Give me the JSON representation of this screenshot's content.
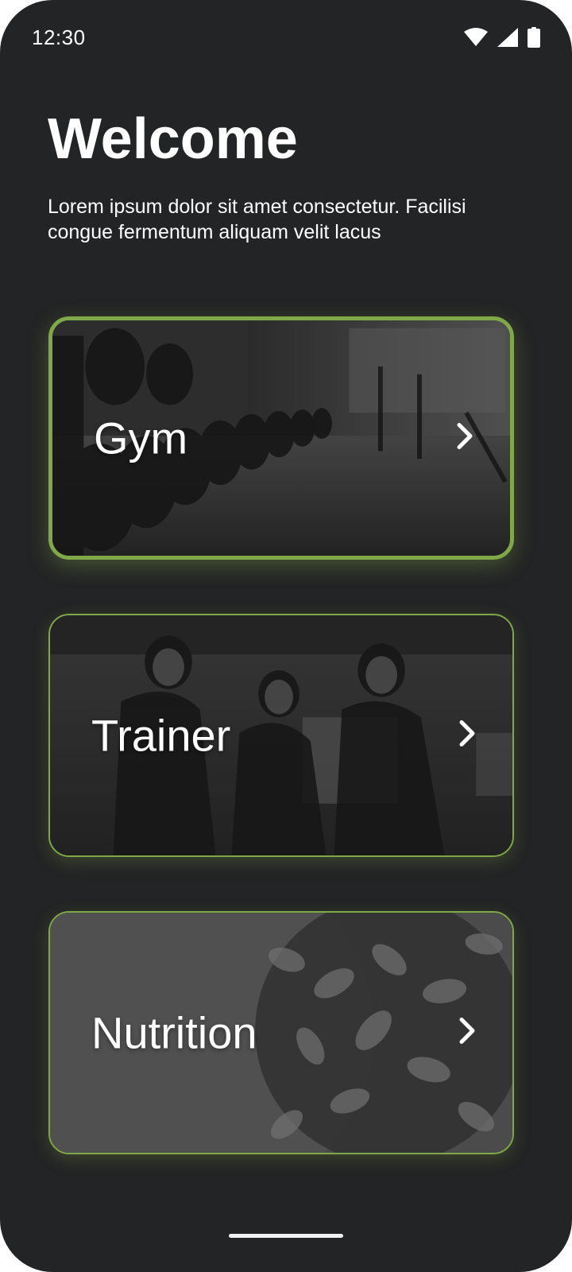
{
  "status_bar": {
    "time": "12:30",
    "icons": [
      "wifi-icon",
      "cellular-signal-icon",
      "battery-icon"
    ]
  },
  "header": {
    "title": "Welcome",
    "subtitle": "Lorem ipsum dolor sit amet consectetur. Facilisi congue fermentum aliquam velit lacus"
  },
  "cards": [
    {
      "label": "Gym",
      "image": "gym-dumbbell-rack-photo",
      "selected": true,
      "icon": "chevron-right-icon"
    },
    {
      "label": "Trainer",
      "image": "women-exercising-photo",
      "selected": false,
      "icon": "chevron-right-icon"
    },
    {
      "label": "Nutrition",
      "image": "pasta-salad-photo",
      "selected": false,
      "icon": "chevron-right-icon"
    }
  ],
  "colors": {
    "background": "#232425",
    "accent": "#7fa848",
    "text": "#ffffff"
  }
}
